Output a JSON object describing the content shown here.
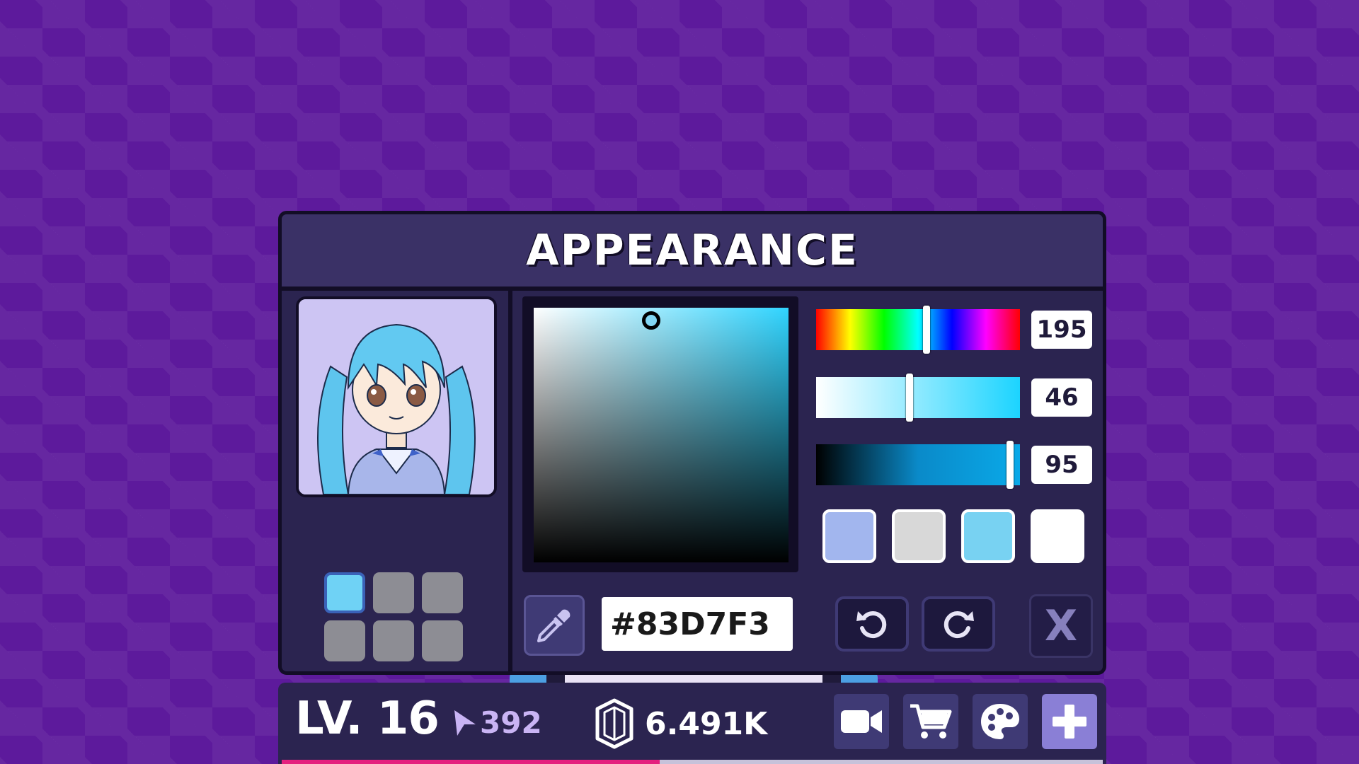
{
  "title": "APPEARANCE",
  "color_picker": {
    "hue": "195",
    "saturation": "46",
    "value": "95",
    "hue_fraction": 0.54,
    "saturation_fraction": 0.46,
    "value_fraction": 0.95,
    "hex": "#83D7F3",
    "swatches": [
      "#a2b6ee",
      "#d8d8d8",
      "#78d2f2",
      "#ffffff"
    ]
  },
  "slots": {
    "count": 6,
    "active_index": 0,
    "active_color": "#6fd2f5"
  },
  "buttons": {
    "close_label": "X",
    "eyedropper_icon": "eyedropper-icon",
    "undo_icon": "undo-icon",
    "redo_icon": "redo-icon"
  },
  "bottom_bar": {
    "level": "LV. 16",
    "arrows": "392",
    "gems": "6.491K",
    "xp_fraction": 0.46,
    "icons": [
      "video-camera-icon",
      "shopping-cart-icon",
      "palette-icon",
      "plus-icon"
    ]
  },
  "colors": {
    "background": "#5d1a9c",
    "panel": "#2b2450",
    "title_bar": "#3a3166",
    "accent": "#e4207e"
  }
}
